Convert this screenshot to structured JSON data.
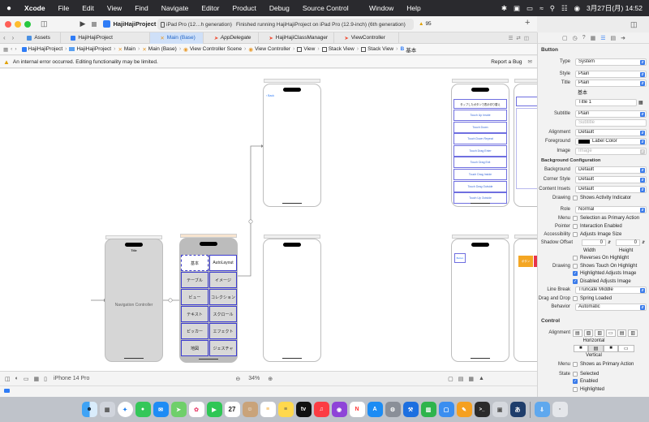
{
  "menubar": {
    "apple": "",
    "items": [
      "Xcode",
      "File",
      "Edit",
      "View",
      "Find",
      "Navigate",
      "Editor",
      "Product",
      "Debug",
      "Source Control"
    ],
    "center_items": [
      "Window",
      "Help"
    ],
    "datetime": "3月27日(月)  14:52"
  },
  "toolbar": {
    "project": "HajiHajiProject",
    "scheme_target": "iPad Pro (12…h generation)",
    "status": "Finished running HajiHajiProject on iPad Pro (12.9-inch) (6th generation)",
    "warnings": "95",
    "add": "+"
  },
  "tabs": [
    {
      "label": "Assets"
    },
    {
      "label": "HajiHajiProject"
    },
    {
      "label": "Main (Base)"
    },
    {
      "label": "AppDelegate"
    },
    {
      "label": "HajiHajiClassManager"
    },
    {
      "label": "ViewController"
    }
  ],
  "breadcrumb": [
    "HajiHajiProject",
    "HajiHajiProject",
    "Main",
    "Main (Base)",
    "View Controller Scene",
    "View Controller",
    "View",
    "Stack View",
    "Stack View",
    "基本"
  ],
  "issue": {
    "message": "An internal error occurred. Editing functionality may be limited.",
    "report": "Report a Bug"
  },
  "canvas": {
    "nav_controller_title": "Navigation Controller",
    "nav_top_title": "Title",
    "back_label": "Back",
    "grid_buttons": [
      "基本",
      "AutoLayout",
      "テーブル",
      "イメージ",
      "ビュー",
      "コレクション",
      "テキスト",
      "スクロール",
      "ピッカー",
      "エフェクト",
      "地図",
      "ジェスチャ"
    ],
    "list_header": "タップしたボタンで表示切り替え",
    "list_buttons": [
      "Touch Up Inside",
      "Touch Down",
      "Touch Down Repeat",
      "Touch Drag Enter",
      "Touch Drag Exit",
      "Touch Drag Inside",
      "Touch Drag Outside",
      "Touch Up Outside"
    ],
    "small_button": "Button",
    "partial_button": "ボタン"
  },
  "bottombar": {
    "device": "iPhone 14 Pro",
    "zoom": "34%"
  },
  "inspector": {
    "header": "Button",
    "fields": {
      "type_label": "Type",
      "type": "System",
      "style_label": "Style",
      "style": "Plain",
      "title_label": "Title",
      "title": "Plain",
      "title_text": "基本",
      "font": "Title 1",
      "subtitle_label": "Subtitle",
      "subtitle": "Plain",
      "subtitle_placeholder": "Subtitle",
      "alignment_label": "Alignment",
      "alignment": "Default",
      "foreground_label": "Foreground",
      "foreground": "Label Color",
      "image_label": "Image",
      "image_placeholder": "Image"
    },
    "bg_config": {
      "title": "Background Configuration",
      "background_label": "Background",
      "background": "Default",
      "corner_label": "Corner Style",
      "corner": "Default",
      "insets_label": "Content Insets",
      "insets": "Default",
      "drawing_label": "Drawing",
      "drawing": "Shows Activity Indicator"
    },
    "role_label": "Role",
    "role": "Normal",
    "menu_label": "Menu",
    "menu": "Selection as Primary Action",
    "pointer_label": "Pointer",
    "pointer": "Interaction Enabled",
    "accessibility_label": "Accessibility",
    "accessibility": "Adjusts Image Size",
    "shadow_label": "Shadow Offset",
    "shadow_w": "0",
    "shadow_h": "0",
    "width_label": "Width",
    "height_label": "Height",
    "reverses": "Reverses On Highlight",
    "drawing2_label": "Drawing",
    "shows_touch": "Shows Touch On Highlight",
    "highlighted_adjusts": "Highlighted Adjusts Image",
    "disabled_adjusts": "Disabled Adjusts Image",
    "linebreak_label": "Line Break",
    "linebreak": "Truncate Middle",
    "dragdrop_label": "Drag and Drop",
    "dragdrop": "Spring Loaded",
    "behavior_label": "Behavior",
    "behavior": "Automatic",
    "control_title": "Control",
    "ctl_alignment_label": "Alignment",
    "horizontal": "Horizontal",
    "vertical": "Vertical",
    "ctl_menu_label": "Menu",
    "ctl_menu": "Shows as Primary Action",
    "state_label": "State",
    "state_selected": "Selected",
    "state_enabled": "Enabled",
    "state_highlighted": "Highlighted"
  },
  "dock": {
    "calendar_day": "27",
    "apps": [
      "finder",
      "launchpad",
      "safari",
      "messages",
      "mail",
      "maps",
      "photos",
      "facetime",
      "calendar",
      "contacts",
      "reminders",
      "notes",
      "tv",
      "music",
      "podcasts",
      "news",
      "app-store",
      "system-settings",
      "xcode",
      "numbers",
      "keynote",
      "pages",
      "terminal",
      "screenshot"
    ]
  }
}
